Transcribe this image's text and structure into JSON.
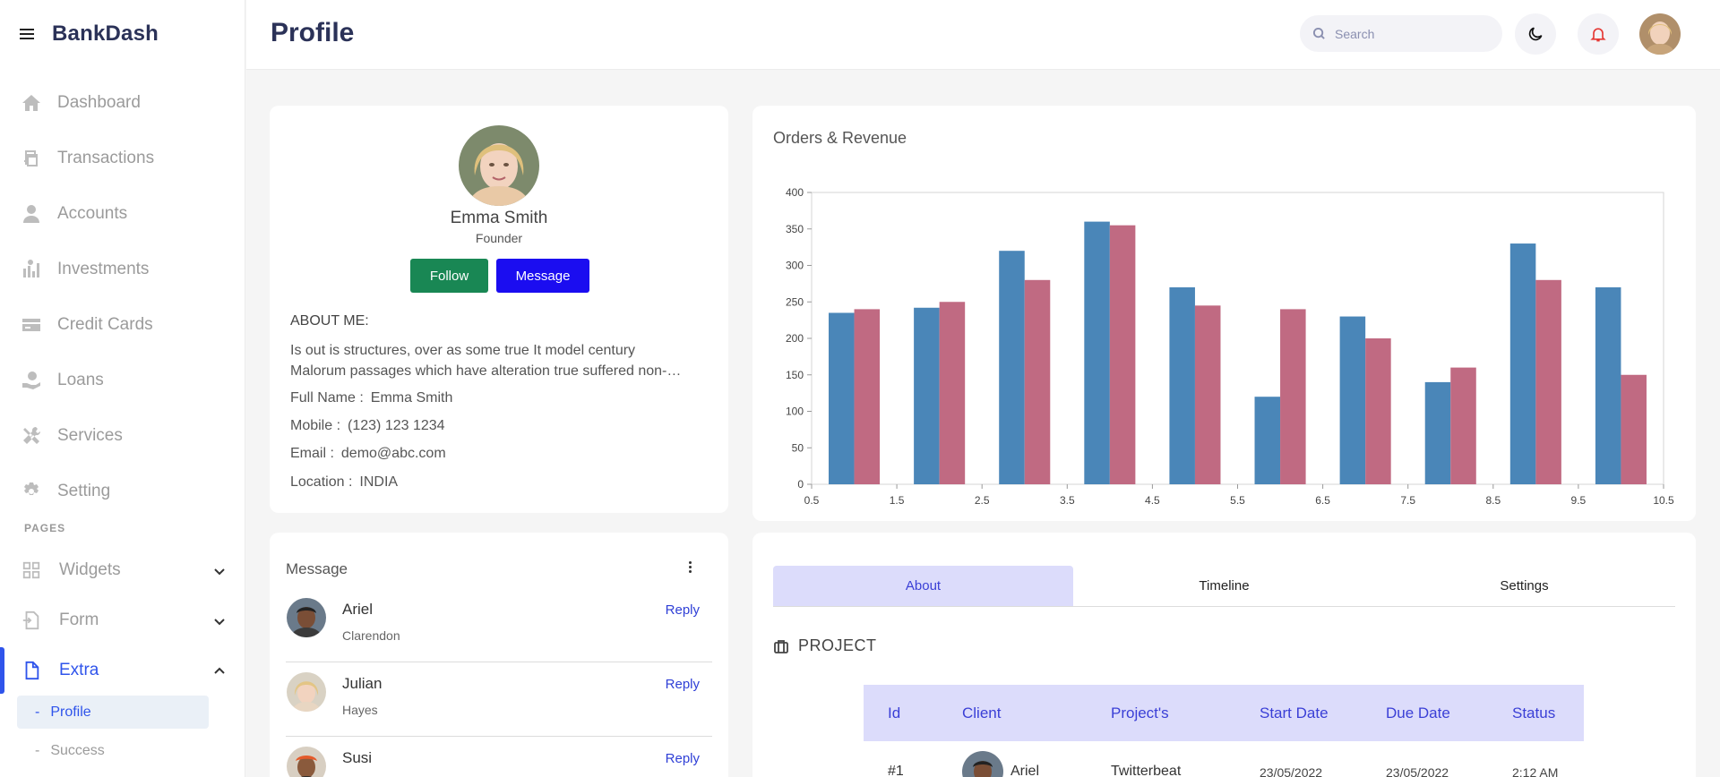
{
  "app": {
    "brand": "BankDash"
  },
  "header": {
    "title": "Profile",
    "search_placeholder": "Search"
  },
  "sidebar": {
    "items": [
      {
        "label": "Dashboard",
        "icon": "home-icon"
      },
      {
        "label": "Transactions",
        "icon": "transactions-icon"
      },
      {
        "label": "Accounts",
        "icon": "user-icon"
      },
      {
        "label": "Investments",
        "icon": "investments-icon"
      },
      {
        "label": "Credit Cards",
        "icon": "credit-card-icon"
      },
      {
        "label": "Loans",
        "icon": "loan-icon"
      },
      {
        "label": "Services",
        "icon": "tools-icon"
      },
      {
        "label": "Setting",
        "icon": "gear-icon"
      }
    ],
    "pages_label": "PAGES",
    "groups": [
      {
        "label": "Widgets",
        "icon": "grid-icon",
        "expanded": false
      },
      {
        "label": "Form",
        "icon": "form-icon",
        "expanded": false
      },
      {
        "label": "Extra",
        "icon": "file-icon",
        "expanded": true
      }
    ],
    "sub_items": [
      {
        "label": "Profile",
        "active": true
      },
      {
        "label": "Success",
        "active": false
      }
    ]
  },
  "profile": {
    "name": "Emma Smith",
    "role": "Founder",
    "follow_label": "Follow",
    "message_label": "Message",
    "about_heading": "ABOUT ME:",
    "about_line1": "Is out is structures, over as some true It model century",
    "about_line2": "Malorum passages which have alteration true suffered non-…",
    "fields": [
      {
        "key": "Full Name :",
        "value": "Emma Smith"
      },
      {
        "key": "Mobile :",
        "value": "(123) 123 1234"
      },
      {
        "key": "Email :",
        "value": "demo@abc.com"
      },
      {
        "key": "Location :",
        "value": "INDIA"
      }
    ]
  },
  "chart_card": {
    "title": "Orders & Revenue"
  },
  "chart_data": {
    "type": "bar",
    "title": "Orders & Revenue",
    "x": [
      1,
      2,
      3,
      4,
      5,
      6,
      7,
      8,
      9,
      10
    ],
    "xticks": [
      "0.5",
      "1.5",
      "2.5",
      "3.5",
      "4.5",
      "5.5",
      "6.5",
      "7.5",
      "8.5",
      "9.5",
      "10.5"
    ],
    "yticks": [
      "0",
      "50",
      "100",
      "150",
      "200",
      "250",
      "300",
      "350",
      "400"
    ],
    "xlim": [
      0.5,
      10.5
    ],
    "ylim": [
      0,
      400
    ],
    "series": [
      {
        "values": [
          235,
          242,
          320,
          360,
          270,
          120,
          230,
          140,
          330,
          270
        ],
        "color": "#4a86b8"
      },
      {
        "values": [
          240,
          250,
          280,
          355,
          245,
          240,
          200,
          160,
          280,
          150
        ],
        "color": "#c06a82"
      }
    ],
    "grid": false
  },
  "messages": {
    "title": "Message",
    "items": [
      {
        "name": "Ariel",
        "sub": "Clarendon",
        "reply": "Reply"
      },
      {
        "name": "Julian",
        "sub": "Hayes",
        "reply": "Reply"
      },
      {
        "name": "Susi",
        "sub": "",
        "reply": "Reply"
      }
    ]
  },
  "tabs": {
    "items": [
      "About",
      "Timeline",
      "Settings"
    ],
    "active": "About"
  },
  "project": {
    "heading": "PROJECT",
    "columns": [
      "Id",
      "Client",
      "Project's",
      "Start Date",
      "Due Date",
      "Status"
    ],
    "rows": [
      {
        "id": "#1",
        "client": "Ariel",
        "project": "Twitterbeat",
        "start": "23/05/2022",
        "due": "23/05/2022",
        "status": "2:12 AM"
      }
    ]
  },
  "colors": {
    "accent": "#2f54eb",
    "brand": "#2b3258",
    "follow": "#198754",
    "message": "#1b0df0",
    "tab_active": "#dcdcfb"
  }
}
